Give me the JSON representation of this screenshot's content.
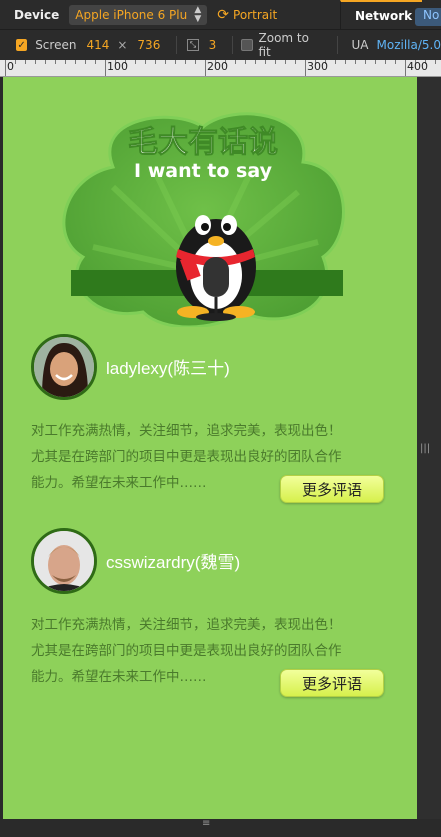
{
  "toolbar": {
    "device_label": "Device",
    "device_value": "Apple iPhone 6 Plu",
    "orientation": "Portrait",
    "network_tab": "Network",
    "network_value": "No",
    "screen_label": "Screen",
    "screen_width": "414",
    "times": "×",
    "screen_height": "736",
    "dpr": "3",
    "zoom_label": "Zoom to fit",
    "ua_label": "UA",
    "ua_value": "Mozilla/5.0"
  },
  "ruler": {
    "labels": [
      "0",
      "100",
      "200",
      "300",
      "400"
    ]
  },
  "colors": {
    "page_bg": "#8ed15a",
    "accent": "#f5a623",
    "button": "#e4f86a",
    "avatar_ring": "#2f6b16"
  },
  "banner": {
    "title_cn": "毛大有话说",
    "title_en": "I want to say"
  },
  "users": [
    {
      "name": "ladylexy(陈三十)",
      "comment_lines": [
        "对工作充满热情，关注细节，追求完美，表现出色！",
        "尤其是在跨部门的项目中更是表现出良好的团队合作",
        "能力。希望在未来工作中……"
      ],
      "more_label": "更多评语"
    },
    {
      "name": "csswizardry(魏雪)",
      "comment_lines": [
        "对工作充满热情，关注细节，追求完美，表现出色！",
        "尤其是在跨部门的项目中更是表现出良好的团队合作",
        "能力。希望在未来工作中……"
      ],
      "more_label": "更多评语"
    }
  ]
}
